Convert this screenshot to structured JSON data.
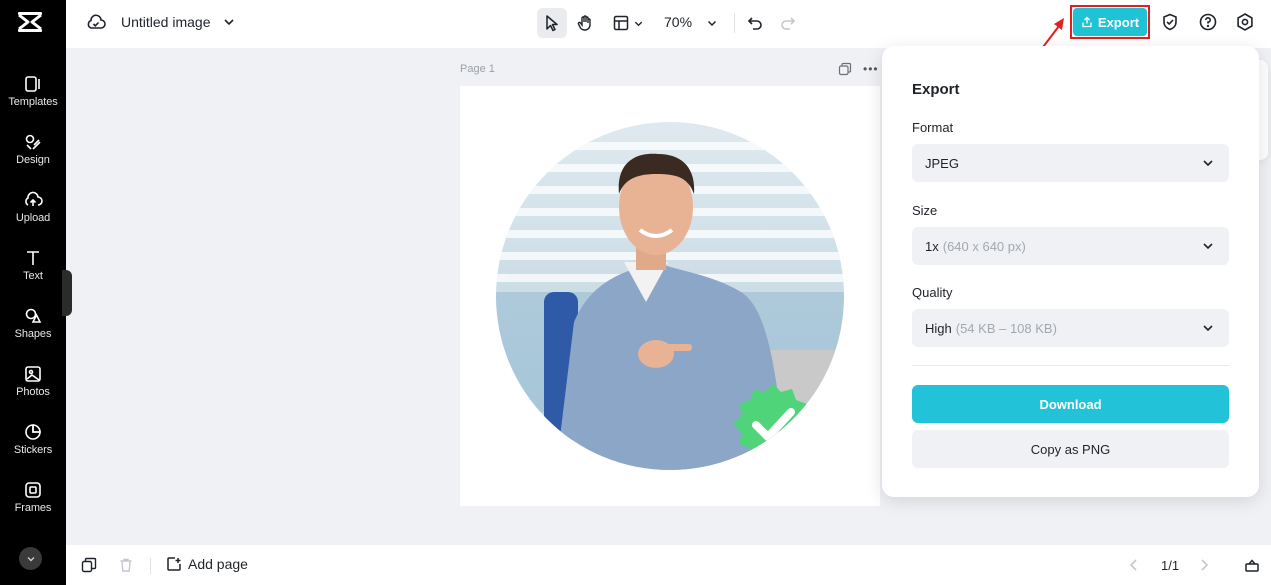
{
  "sidebar": {
    "logo_icon": "capcut-logo-icon",
    "items": [
      {
        "label": "Templates",
        "icon": "templates-icon"
      },
      {
        "label": "Design",
        "icon": "design-icon"
      },
      {
        "label": "Upload",
        "icon": "upload-icon"
      },
      {
        "label": "Text",
        "icon": "text-icon"
      },
      {
        "label": "Shapes",
        "icon": "shapes-icon"
      },
      {
        "label": "Photos",
        "icon": "photos-icon"
      },
      {
        "label": "Stickers",
        "icon": "stickers-icon"
      },
      {
        "label": "Frames",
        "icon": "frames-icon"
      }
    ]
  },
  "header": {
    "title": "Untitled image",
    "zoom": "70%",
    "export_label": "Export",
    "accent_color": "#20c3d6"
  },
  "canvas": {
    "page_label": "Page 1"
  },
  "export_panel": {
    "title": "Export",
    "format": {
      "label": "Format",
      "value": "JPEG"
    },
    "size": {
      "label": "Size",
      "value": "1x",
      "detail": "(640 x 640 px)"
    },
    "quality": {
      "label": "Quality",
      "value": "High",
      "detail": "(54 KB – 108 KB)"
    },
    "download_label": "Download",
    "copy_label": "Copy as PNG"
  },
  "footer": {
    "add_page_label": "Add page",
    "pager": "1/1"
  }
}
